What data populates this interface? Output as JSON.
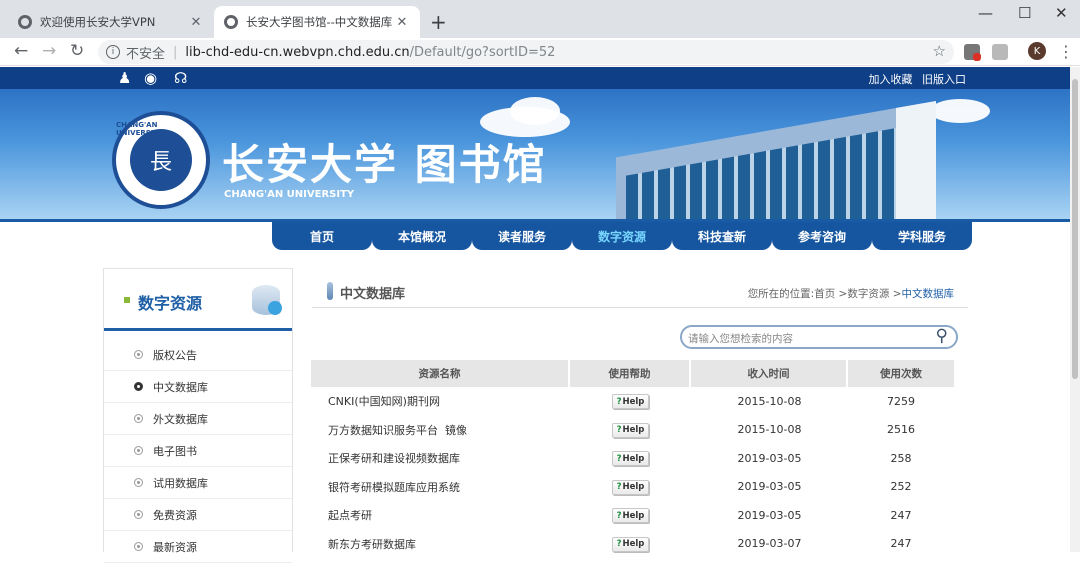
{
  "browser": {
    "tabs": [
      {
        "title": "欢迎使用长安大学VPN",
        "active": false
      },
      {
        "title": "长安大学图书馆--中文数据库",
        "active": true
      }
    ],
    "security_label": "不安全",
    "url_host": "lib-chd-edu-cn.webvpn.chd.edu.cn",
    "url_path": "/Default/go?sortID=52",
    "profile_initial": "K",
    "new_tab_symbol": "+",
    "window_controls": [
      "—",
      "☐",
      "✕"
    ]
  },
  "site": {
    "top_links": [
      "加入收藏",
      "旧版入口"
    ],
    "school_name": "长安大学 图书馆",
    "school_name_en": "CHANG'AN UNIVERSITY",
    "seal_ring": "CHANG'AN UNIVERSITY",
    "nav": [
      {
        "label": "首页",
        "active": false
      },
      {
        "label": "本馆概况",
        "active": false
      },
      {
        "label": "读者服务",
        "active": false
      },
      {
        "label": "数字资源",
        "active": true
      },
      {
        "label": "科技查新",
        "active": false
      },
      {
        "label": "参考咨询",
        "active": false
      },
      {
        "label": "学科服务",
        "active": false
      }
    ],
    "colors": {
      "nav_bg": "#1656a0",
      "nav_active_text": "#78d6ff",
      "topbar": "#0f3f86"
    }
  },
  "sidebar": {
    "title": "数字资源",
    "items": [
      {
        "label": "版权公告",
        "active": false
      },
      {
        "label": "中文数据库",
        "active": true
      },
      {
        "label": "外文数据库",
        "active": false
      },
      {
        "label": "电子图书",
        "active": false
      },
      {
        "label": "试用数据库",
        "active": false
      },
      {
        "label": "免费资源",
        "active": false
      },
      {
        "label": "最新资源",
        "active": false
      }
    ]
  },
  "main": {
    "title": "中文数据库",
    "breadcrumb": {
      "prefix": "您所在的位置:首页 >数字资源 >",
      "current": "中文数据库"
    },
    "search_placeholder": "请输入您想检索的内容",
    "columns": [
      "资源名称",
      "使用帮助",
      "收入时间",
      "使用次数"
    ],
    "help_label": "Help",
    "rows": [
      {
        "name": "CNKI(中国知网)期刊网",
        "date": "2015-10-08",
        "count": "7259"
      },
      {
        "name": "万方数据知识服务平台  镜像",
        "date": "2015-10-08",
        "count": "2516"
      },
      {
        "name": "正保考研和建设视频数据库",
        "date": "2019-03-05",
        "count": "258"
      },
      {
        "name": "银符考研模拟题库应用系统",
        "date": "2019-03-05",
        "count": "252"
      },
      {
        "name": "起点考研",
        "date": "2019-03-05",
        "count": "247"
      },
      {
        "name": "新东方考研数据库",
        "date": "2019-03-07",
        "count": "247"
      }
    ]
  }
}
